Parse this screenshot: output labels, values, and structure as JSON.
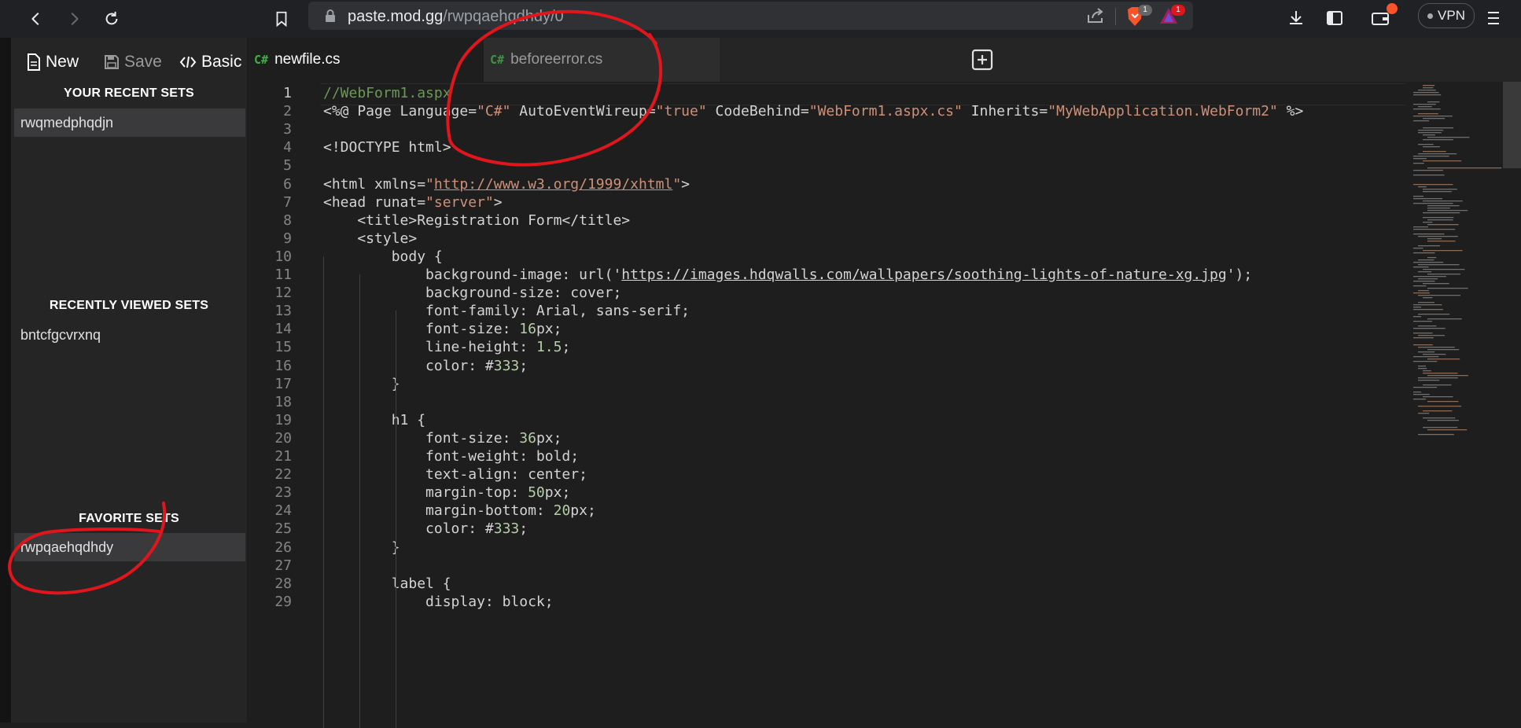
{
  "browser": {
    "url_host": "paste.mod.gg",
    "url_path": "/rwpqaehqdhdy/0",
    "brave_shield_badge": "1",
    "rewards_badge": "1",
    "vpn_label": "VPN"
  },
  "toolbar": {
    "new_label": "New",
    "save_label": "Save",
    "basic_label": "Basic"
  },
  "sidebar": {
    "recent_title": "YOUR RECENT SETS",
    "recent_items": [
      "rwqmedphqdjn"
    ],
    "viewed_title": "RECENTLY VIEWED SETS",
    "viewed_items": [
      "bntcfgcvrxnq"
    ],
    "favorite_title": "FAVORITE SETS",
    "favorite_items": [
      "rwpqaehqdhdy"
    ]
  },
  "tabs": [
    {
      "icon": "C#",
      "label": "newfile.cs",
      "active": true
    },
    {
      "icon": "C#",
      "label": "beforeerror.cs",
      "active": false
    }
  ],
  "editor": {
    "line_numbers": [
      "1",
      "2",
      "3",
      "4",
      "5",
      "6",
      "7",
      "8",
      "9",
      "10",
      "11",
      "12",
      "13",
      "14",
      "15",
      "16",
      "17",
      "18",
      "19",
      "20",
      "21",
      "22",
      "23",
      "24",
      "25",
      "26",
      "27",
      "28",
      "29"
    ],
    "lines": [
      [
        {
          "t": "//WebForm1.aspx",
          "c": "com"
        }
      ],
      [
        {
          "t": "<%@ Page Language=",
          "c": ""
        },
        {
          "t": "\"C#\"",
          "c": "str"
        },
        {
          "t": " AutoEventWireup=",
          "c": ""
        },
        {
          "t": "\"true\"",
          "c": "str"
        },
        {
          "t": " CodeBehind=",
          "c": ""
        },
        {
          "t": "\"WebForm1.aspx.cs\"",
          "c": "str"
        },
        {
          "t": " Inherits=",
          "c": ""
        },
        {
          "t": "\"MyWebApplication.WebForm2\"",
          "c": "str"
        },
        {
          "t": " %>",
          "c": ""
        }
      ],
      [],
      [
        {
          "t": "<!DOCTYPE html>",
          "c": ""
        }
      ],
      [],
      [
        {
          "t": "<html xmlns=",
          "c": ""
        },
        {
          "t": "\"",
          "c": "str"
        },
        {
          "t": "http://www.w3.org/1999/xhtml",
          "c": "strlnk"
        },
        {
          "t": "\"",
          "c": "str"
        },
        {
          "t": ">",
          "c": ""
        }
      ],
      [
        {
          "t": "<head runat=",
          "c": ""
        },
        {
          "t": "\"server\"",
          "c": "str"
        },
        {
          "t": ">",
          "c": ""
        }
      ],
      [
        {
          "t": "    <title>Registration Form</title>",
          "c": ""
        }
      ],
      [
        {
          "t": "    <style>",
          "c": ""
        }
      ],
      [
        {
          "t": "        body {",
          "c": ""
        }
      ],
      [
        {
          "t": "            background-image: url('",
          "c": ""
        },
        {
          "t": "https://images.hdqwalls.com/wallpapers/soothing-lights-of-nature-xg.jpg",
          "c": "lnk"
        },
        {
          "t": "');",
          "c": ""
        }
      ],
      [
        {
          "t": "            background-size: cover;",
          "c": ""
        }
      ],
      [
        {
          "t": "            font-family: Arial, sans-serif;",
          "c": ""
        }
      ],
      [
        {
          "t": "            font-size: ",
          "c": ""
        },
        {
          "t": "16",
          "c": "num"
        },
        {
          "t": "px;",
          "c": ""
        }
      ],
      [
        {
          "t": "            line-height: ",
          "c": ""
        },
        {
          "t": "1.5",
          "c": "num"
        },
        {
          "t": ";",
          "c": ""
        }
      ],
      [
        {
          "t": "            color: #",
          "c": ""
        },
        {
          "t": "333",
          "c": "num"
        },
        {
          "t": ";",
          "c": ""
        }
      ],
      [
        {
          "t": "        }",
          "c": ""
        }
      ],
      [],
      [
        {
          "t": "        h1 {",
          "c": ""
        }
      ],
      [
        {
          "t": "            font-size: ",
          "c": ""
        },
        {
          "t": "36",
          "c": "num"
        },
        {
          "t": "px;",
          "c": ""
        }
      ],
      [
        {
          "t": "            font-weight: bold;",
          "c": ""
        }
      ],
      [
        {
          "t": "            text-align: center;",
          "c": ""
        }
      ],
      [
        {
          "t": "            margin-top: ",
          "c": ""
        },
        {
          "t": "50",
          "c": "num"
        },
        {
          "t": "px;",
          "c": ""
        }
      ],
      [
        {
          "t": "            margin-bottom: ",
          "c": ""
        },
        {
          "t": "20",
          "c": "num"
        },
        {
          "t": "px;",
          "c": ""
        }
      ],
      [
        {
          "t": "            color: #",
          "c": ""
        },
        {
          "t": "333",
          "c": "num"
        },
        {
          "t": ";",
          "c": ""
        }
      ],
      [
        {
          "t": "        }",
          "c": ""
        }
      ],
      [],
      [
        {
          "t": "        label {",
          "c": ""
        }
      ],
      [
        {
          "t": "            display: block;",
          "c": ""
        }
      ]
    ]
  },
  "colors": {
    "annotation": "#e0161c",
    "csharp_icon": "#3fae49"
  }
}
